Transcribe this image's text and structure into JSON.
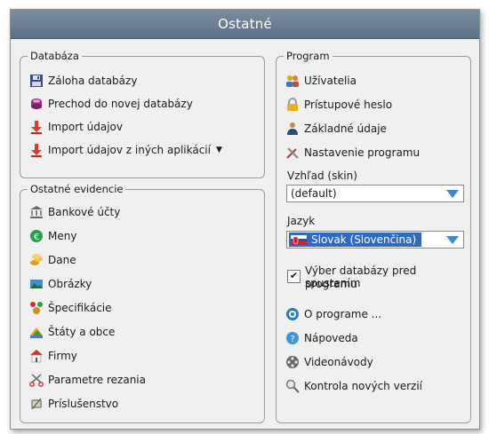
{
  "window": {
    "title": "Ostatné"
  },
  "databaza": {
    "title": "Databáza",
    "items": [
      {
        "label": "Záloha databázy",
        "icon": "floppy-disk-icon"
      },
      {
        "label": "Prechod do novej databázy",
        "icon": "database-migrate-icon"
      },
      {
        "label": "Import údajov",
        "icon": "import-arrow-icon"
      },
      {
        "label": "Import údajov z iných aplikácií",
        "icon": "import-arrow-icon",
        "caret": "▼"
      }
    ]
  },
  "ostatne": {
    "title": "Ostatné evidencie",
    "items": [
      {
        "label": "Bankové účty",
        "icon": "bank-icon"
      },
      {
        "label": "Meny",
        "icon": "currency-icon"
      },
      {
        "label": "Dane",
        "icon": "coins-icon"
      },
      {
        "label": "Obrázky",
        "icon": "image-icon"
      },
      {
        "label": "Špecifikácie",
        "icon": "specification-icon"
      },
      {
        "label": "Štáty a obce",
        "icon": "map-icon"
      },
      {
        "label": "Firmy",
        "icon": "company-icon"
      },
      {
        "label": "Parametre rezania",
        "icon": "scissors-icon"
      },
      {
        "label": "Príslušenstvo",
        "icon": "accessories-icon"
      }
    ]
  },
  "program": {
    "title": "Program",
    "items": [
      {
        "label": "Užívatelia",
        "icon": "users-icon"
      },
      {
        "label": "Prístupové heslo",
        "icon": "lock-icon"
      },
      {
        "label": "Základné údaje",
        "icon": "person-icon"
      },
      {
        "label": "Nastavenie programu",
        "icon": "tools-icon"
      }
    ],
    "skin_label": "Vzhľad (skin)",
    "skin_value": "(default)",
    "lang_label": "Jazyk",
    "lang_value": "Slovak (Slovenčina)",
    "checkbox_label_1": "Výber databázy pred spustením",
    "checkbox_label_2": "programu",
    "checkbox_checked": true,
    "links": [
      {
        "label": "O programe ...",
        "icon": "info-icon"
      },
      {
        "label": "Nápoveda",
        "icon": "help-icon"
      },
      {
        "label": "Videonávody",
        "icon": "film-reel-icon"
      },
      {
        "label": "Kontrola nových verzií",
        "icon": "magnifier-icon"
      }
    ]
  },
  "colors": {
    "titlebar": "#6b7e93",
    "accent": "#3069c3"
  }
}
